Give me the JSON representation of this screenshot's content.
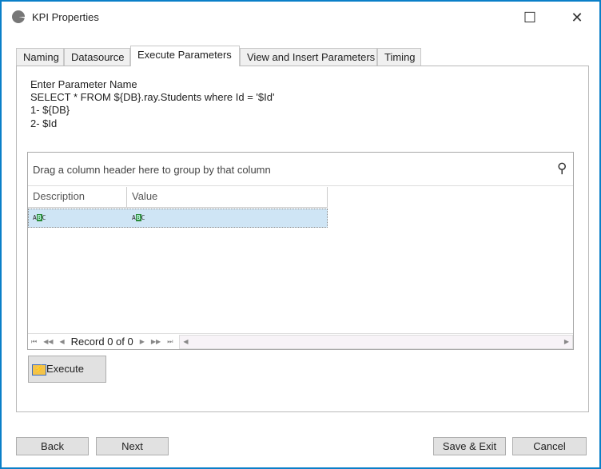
{
  "window": {
    "title": "KPI Properties",
    "maximize_icon": "☐",
    "close_icon": "✕"
  },
  "tabs": [
    {
      "label": "Naming"
    },
    {
      "label": "Datasource"
    },
    {
      "label": "Execute Parameters"
    },
    {
      "label": "View and Insert Parameters"
    },
    {
      "label": "Timing"
    }
  ],
  "info": {
    "line1": "Enter Parameter Name",
    "line2": "SELECT * FROM ${DB}.ray.Students where Id = '$Id'",
    "line3": "1- ${DB}",
    "line4": "2- $Id"
  },
  "grid": {
    "group_hint": "Drag a column header here to group by that column",
    "columns": [
      "Description",
      "Value"
    ],
    "rows": [
      {
        "description": "",
        "value": ""
      }
    ],
    "record_text": "Record 0 of 0"
  },
  "buttons": {
    "execute": "Execute",
    "back": "Back",
    "next": "Next",
    "save_exit": "Save & Exit",
    "cancel": "Cancel"
  }
}
